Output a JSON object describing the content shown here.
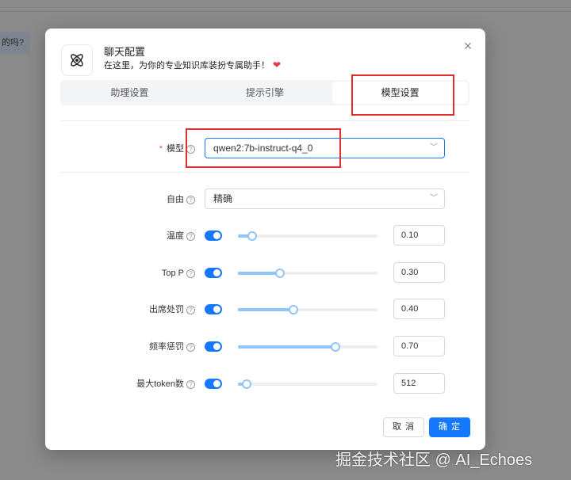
{
  "background": {
    "bubble_text": "的吗?"
  },
  "dialog": {
    "title": "聊天配置",
    "subtitle": "在这里，为你的专业知识库装扮专属助手！",
    "tabs": [
      {
        "label": "助理设置",
        "active": false
      },
      {
        "label": "提示引擎",
        "active": false
      },
      {
        "label": "模型设置",
        "active": true
      }
    ],
    "model": {
      "label": "模型",
      "value": "qwen2:7b-instruct-q4_0"
    },
    "freedom": {
      "label": "自由",
      "value": "精确"
    },
    "params": [
      {
        "label": "温度",
        "value": "0.10",
        "level": 0.1,
        "enabled": true
      },
      {
        "label": "Top P",
        "value": "0.30",
        "level": 0.3,
        "enabled": true
      },
      {
        "label": "出席处罚",
        "value": "0.40",
        "level": 0.4,
        "enabled": true
      },
      {
        "label": "频率惩罚",
        "value": "0.70",
        "level": 0.7,
        "enabled": true
      },
      {
        "label": "最大token数",
        "value": "512",
        "level": 0.06,
        "enabled": true
      }
    ],
    "cancel_label": "取 消",
    "ok_label": "确 定"
  },
  "watermark": "掘金技术社区 @ AI_Echoes",
  "colors": {
    "accent": "#1677ff",
    "slider": "#91c4f8",
    "annotation": "#e02f2f"
  }
}
